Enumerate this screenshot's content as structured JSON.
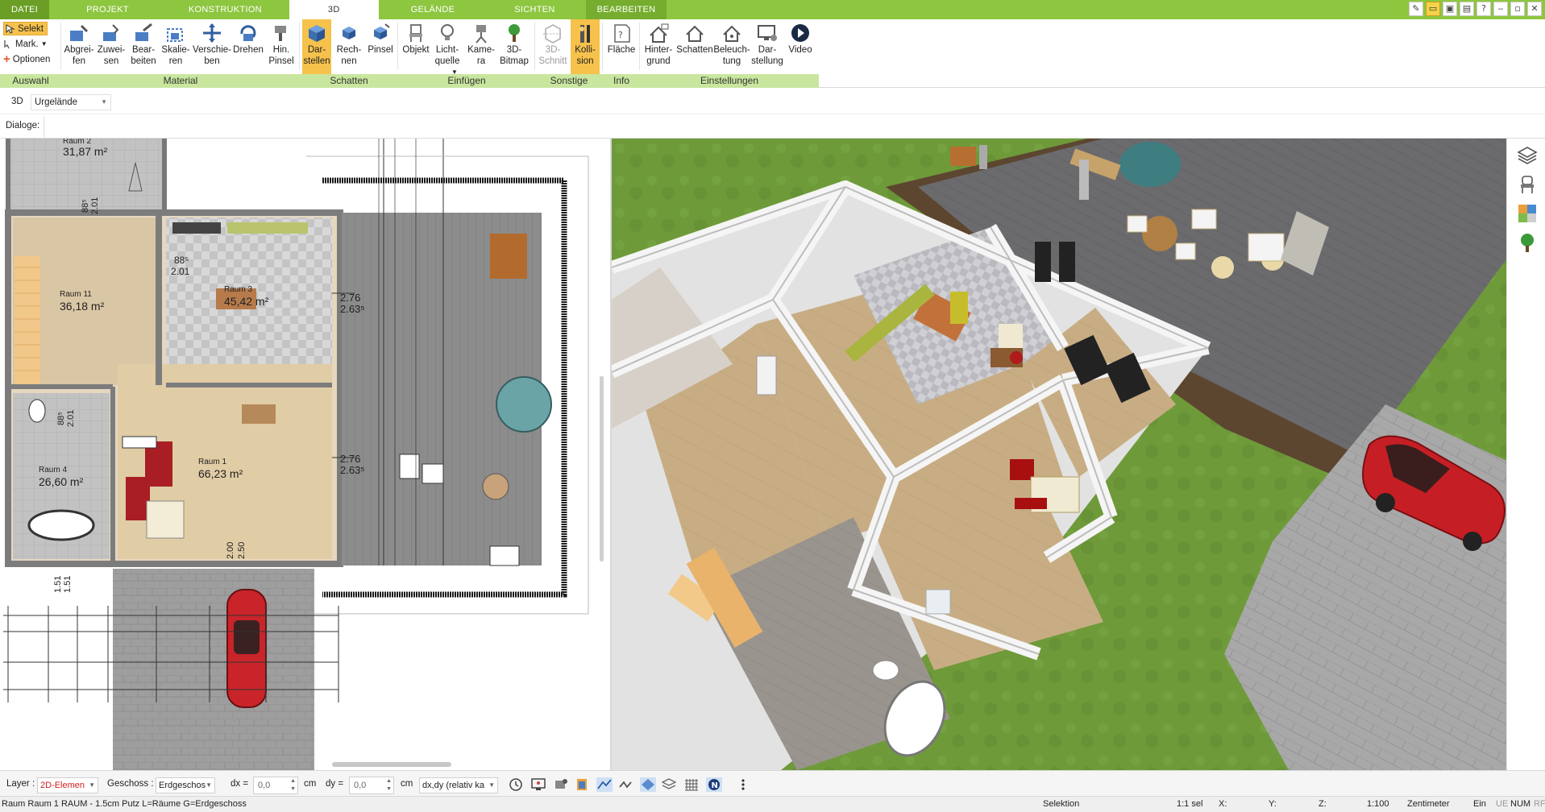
{
  "tabs": [
    {
      "label": "DATEI"
    },
    {
      "label": "PROJEKT"
    },
    {
      "label": "KONSTRUKTION"
    },
    {
      "label": "3D"
    },
    {
      "label": "GELÄNDE"
    },
    {
      "label": "SICHTEN"
    },
    {
      "label": "BEARBEITEN"
    }
  ],
  "active_tab": "3D",
  "ribbon": {
    "auswahl": {
      "selekt": "Selekt",
      "mark": "Mark.",
      "optionen": "Optionen",
      "label": "Auswahl"
    },
    "material": {
      "label": "Material",
      "buttons": [
        "Abgrei-\nfen",
        "Zuwei-\nsen",
        "Bear-\nbeiten",
        "Skalie-\nren",
        "Verschie-\nben",
        "Drehen",
        "Hin.\nPinsel"
      ]
    },
    "schatten": {
      "label": "Schatten",
      "buttons": [
        "Dar-\nstellen",
        "Rech-\nnen",
        "Pinsel"
      ]
    },
    "einfuegen": {
      "label": "Einfügen",
      "buttons": [
        "Objekt",
        "Licht-\nquelle",
        "Kame-\nra",
        "3D-\nBitmap"
      ]
    },
    "sonstige": {
      "label": "Sonstige",
      "buttons": [
        "3D-\nSchnitt",
        "Kolli-\nsion"
      ]
    },
    "info": {
      "label": "Info",
      "buttons": [
        "Fläche"
      ]
    },
    "einstellungen": {
      "label": "Einstellungen",
      "buttons": [
        "Hinter-\ngrund",
        "Schatten",
        "Beleuch-\ntung",
        "Dar-\nstellung",
        "Video"
      ]
    }
  },
  "view_row": {
    "mode": "3D",
    "terrain": "Urgelände"
  },
  "dialoge": {
    "label": "Dialoge:"
  },
  "floorplan": {
    "rooms": [
      {
        "name": "Raum 2",
        "area": "31,87 m²"
      },
      {
        "name": "Raum 11",
        "area": "36,18 m²"
      },
      {
        "name": "Raum 3",
        "area": "45,42 m²"
      },
      {
        "name": "Raum 4",
        "area": "26,60 m²"
      },
      {
        "name": "Raum 1",
        "area": "66,23 m²"
      }
    ],
    "dims": [
      "88⁵",
      "2.01",
      "88⁵",
      "2.01",
      "88⁵",
      "2.01",
      "2.76",
      "2.63⁵",
      "2.76",
      "2.63⁵",
      "2.00",
      "2.50",
      "1.51",
      "1.51"
    ]
  },
  "bottom": {
    "layer_label": "Layer :",
    "layer_value": "2D-Elemen",
    "geschoss_label": "Geschoss :",
    "geschoss_value": "Erdgeschos",
    "dx_label": "dx =",
    "dx_value": "0,0",
    "dx_unit": "cm",
    "dy_label": "dy =",
    "dy_value": "0,0",
    "dy_unit": "cm",
    "mode": "dx,dy (relativ ka"
  },
  "status": {
    "info": "Raum Raum 1 RAUM - 1.5cm Putz L=Räume G=Erdgeschoss",
    "mode": "Selektion",
    "sel": "1:1 sel",
    "x": "X:",
    "y": "Y:",
    "z": "Z:",
    "scale": "1:100",
    "unit": "Zentimeter",
    "ein": "Ein",
    "ue": "UE",
    "num": "NUM",
    "rf": "RF"
  },
  "colors": {
    "ribbon_green": "#8dc63f",
    "group_label_bg": "#c9e69e",
    "active_button": "#f6c24c"
  }
}
